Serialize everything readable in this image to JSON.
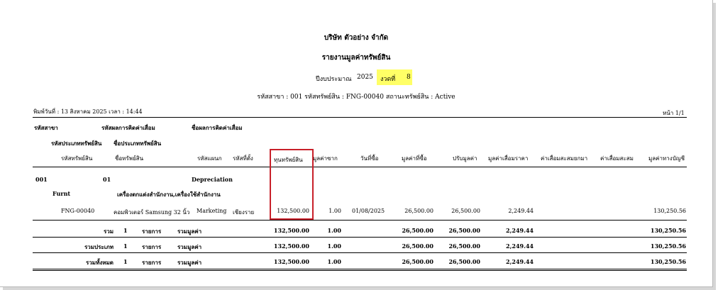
{
  "header": {
    "company": "บริษัท ตัวอย่าง จำกัด",
    "report_title": "รายงานมูลค่าทรัพย์สิน",
    "fiscal_label": "ปีงบประมาณ",
    "fiscal_year": "2025",
    "period_label": "งวดที่",
    "period_value": "8",
    "filters": "รหัสสาขา : 001  รหัสทรัพย์สิน : FNG-00040  สถานะทรัพย์สิน : Active",
    "print_info": "พิมพ์วันที่ : 13 สิงหาคม 2025 เวลา : 14:44",
    "page_info": "หน้า 1/1"
  },
  "group_headers": {
    "branch_code": "รหัสสาขา",
    "depreciation_code": "รหัสผลการคิดค่าเสื่อม",
    "depreciation_name": "ชื่อผลการคิดค่าเสื่อม",
    "asset_type_code": "รหัสประเภททรัพย์สิน",
    "asset_type_name": "ชื่อประเภททรัพย์สิน"
  },
  "columns": {
    "asset_code": "รหัสทรัพย์สิน",
    "asset_name": "ชื่อทรัพย์สิน",
    "department_code": "รหัสแผนก",
    "location_code": "รหัสที่ตั้ง",
    "capital": "ทุนทรัพย์สิน",
    "salvage": "มูลค่าซาก",
    "purchase_date": "วันที่ซื้อ",
    "purchase_value": "มูลค่าที่ซื้อ",
    "adjusted_value": "ปรับมูลค่า",
    "depreciation_per_period": "มูลค่าเสื่อมราคา",
    "accumulated_depreciation_period": "ค่าเสื่อมสะสมยกมา",
    "accumulated_depreciation": "ค่าเสื่อมสะสม",
    "book_value": "มูลค่าทางบัญชี"
  },
  "group": {
    "branch": "001",
    "depreciation_code": "01",
    "depreciation_name": "Depreciation",
    "type_code": "Furnt",
    "type_name": "เครื่องตกแต่งสำนักงาน,เครื่องใช้สำนักงาน"
  },
  "row": {
    "asset_code": "FNG-00040",
    "asset_name": "คอมพิวเตอร์ Samsung 32 นิ้ว",
    "department": "Marketing",
    "location": "เชียงราย",
    "capital": "132,500.00",
    "salvage": "1.00",
    "purchase_date": "01/08/2025",
    "purchase_value": "26,500.00",
    "adjusted_value": "26,500.00",
    "depreciation": "2,249.44",
    "book_value": "130,250.56"
  },
  "totals": [
    {
      "label": "รวม",
      "count": "1",
      "count_label": "รายการ",
      "value_label": "รวมมูลค่า",
      "capital": "132,500.00",
      "salvage": "1.00",
      "purchase_value": "26,500.00",
      "adjusted_value": "26,500.00",
      "depreciation": "2,249.44",
      "book_value": "130,250.56"
    },
    {
      "label": "รวมประเภท",
      "count": "1",
      "count_label": "รายการ",
      "value_label": "รวมมูลค่า",
      "capital": "132,500.00",
      "salvage": "1.00",
      "purchase_value": "26,500.00",
      "adjusted_value": "26,500.00",
      "depreciation": "2,249.44",
      "book_value": "130,250.56"
    },
    {
      "label": "รวมทั้งหมด",
      "count": "1",
      "count_label": "รายการ",
      "value_label": "รวมมูลค่า",
      "capital": "132,500.00",
      "salvage": "1.00",
      "purchase_value": "26,500.00",
      "adjusted_value": "26,500.00",
      "depreciation": "2,249.44",
      "book_value": "130,250.56"
    }
  ],
  "colors": {
    "highlight": "#ffff66",
    "annotation_box": "#c8202a"
  }
}
